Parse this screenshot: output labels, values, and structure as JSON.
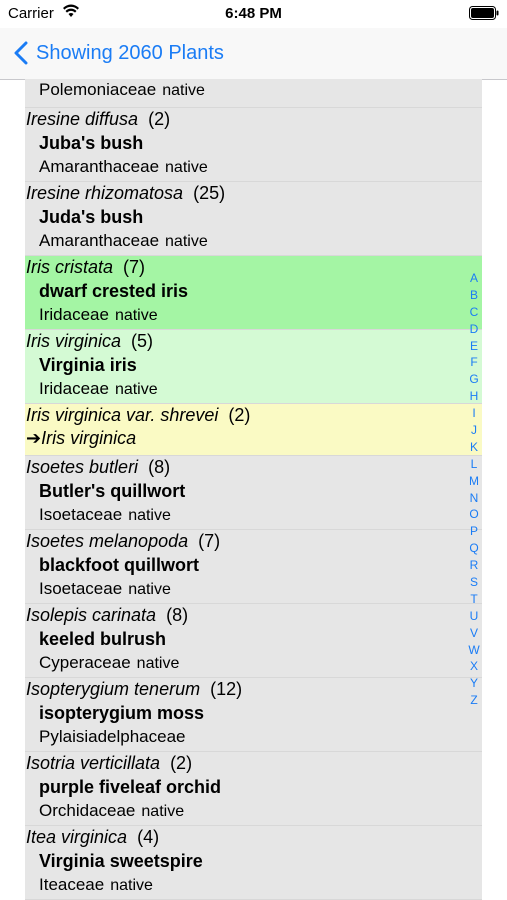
{
  "status_bar": {
    "carrier": "Carrier",
    "time": "6:48 PM"
  },
  "nav": {
    "back_label": "Showing 2060 Plants"
  },
  "entries": [
    {
      "kind": "partial",
      "family": "Polemoniaceae",
      "status": "native"
    },
    {
      "kind": "full",
      "sci": "Iresine diffusa",
      "count": "(2)",
      "common": "Juba's bush",
      "family": "Amaranthaceae",
      "status": "native"
    },
    {
      "kind": "full",
      "sci": "Iresine rhizomatosa",
      "count": "(25)",
      "common": "Juda's bush",
      "family": "Amaranthaceae",
      "status": "native"
    },
    {
      "kind": "full",
      "sci": "Iris cristata",
      "count": "(7)",
      "common": "dwarf crested iris",
      "family": "Iridaceae",
      "status": "native"
    },
    {
      "kind": "full",
      "sci": "Iris virginica",
      "count": "(5)",
      "common": "Virginia iris",
      "family": "Iridaceae",
      "status": "native"
    },
    {
      "kind": "redirect",
      "sci": "Iris virginica var. shrevei",
      "count": "(2)",
      "arrow": "➔",
      "target": "Iris virginica"
    },
    {
      "kind": "full",
      "sci": "Isoetes butleri",
      "count": "(8)",
      "common": "Butler's quillwort",
      "family": "Isoetaceae",
      "status": "native"
    },
    {
      "kind": "full",
      "sci": "Isoetes melanopoda",
      "count": "(7)",
      "common": "blackfoot quillwort",
      "family": "Isoetaceae",
      "status": "native"
    },
    {
      "kind": "full",
      "sci": "Isolepis carinata",
      "count": "(8)",
      "common": "keeled bulrush",
      "family": "Cyperaceae",
      "status": "native"
    },
    {
      "kind": "full",
      "sci": "Isopterygium tenerum",
      "count": "(12)",
      "common": "isopterygium moss",
      "family": "Pylaisiadelphaceae",
      "status": ""
    },
    {
      "kind": "full",
      "sci": "Isotria verticillata",
      "count": "(2)",
      "common": "purple fiveleaf orchid",
      "family": "Orchidaceae",
      "status": "native"
    },
    {
      "kind": "full",
      "sci": "Itea virginica",
      "count": "(4)",
      "common": "Virginia sweetspire",
      "family": "Iteaceae",
      "status": "native"
    }
  ],
  "index_letters": [
    "A",
    "B",
    "C",
    "D",
    "E",
    "F",
    "G",
    "H",
    "I",
    "J",
    "K",
    "L",
    "M",
    "N",
    "O",
    "P",
    "Q",
    "R",
    "S",
    "T",
    "U",
    "V",
    "W",
    "X",
    "Y",
    "Z"
  ],
  "colors": {
    "accent": "#1a7cf5",
    "row_bg": "#e6e6e6",
    "highlight_green": "#a4f5a4",
    "highlight_light_green": "#d4fad4",
    "highlight_yellow": "#fafac4"
  }
}
